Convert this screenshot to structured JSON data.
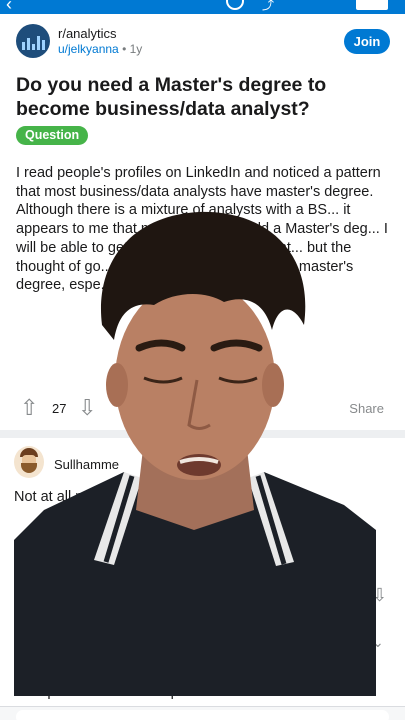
{
  "post": {
    "subreddit": "r/analytics",
    "author": "u/jelkyanna",
    "age": "1y",
    "join_label": "Join",
    "title": "Do you need a Master's degree to become business/data analyst?",
    "flair": "Question",
    "body": "I read people's profiles on LinkedIn and noticed a pattern that most business/data analysts have master's degree. Although there is a mixture of analysts with a BS... it appears to me that most a... them) hold a Master's deg... I will be able to get a... ? I have always want... but the thought of go... rifies me because I do... d a master's degree, espe... xpenses are so over the to...",
    "votes": "27",
    "share_label": "Share"
  },
  "comment": {
    "user": "Sullhamme",
    "text": "Not at all req... t's not even in a t... e",
    "reply": "experience? Internship?"
  },
  "colors": {
    "brand": "#0079d3",
    "flair": "#46b449"
  },
  "icons": [
    "back-icon",
    "search-icon",
    "share-icon",
    "menu-icon",
    "upvote-icon",
    "downvote-icon",
    "chevron-down-icon"
  ]
}
